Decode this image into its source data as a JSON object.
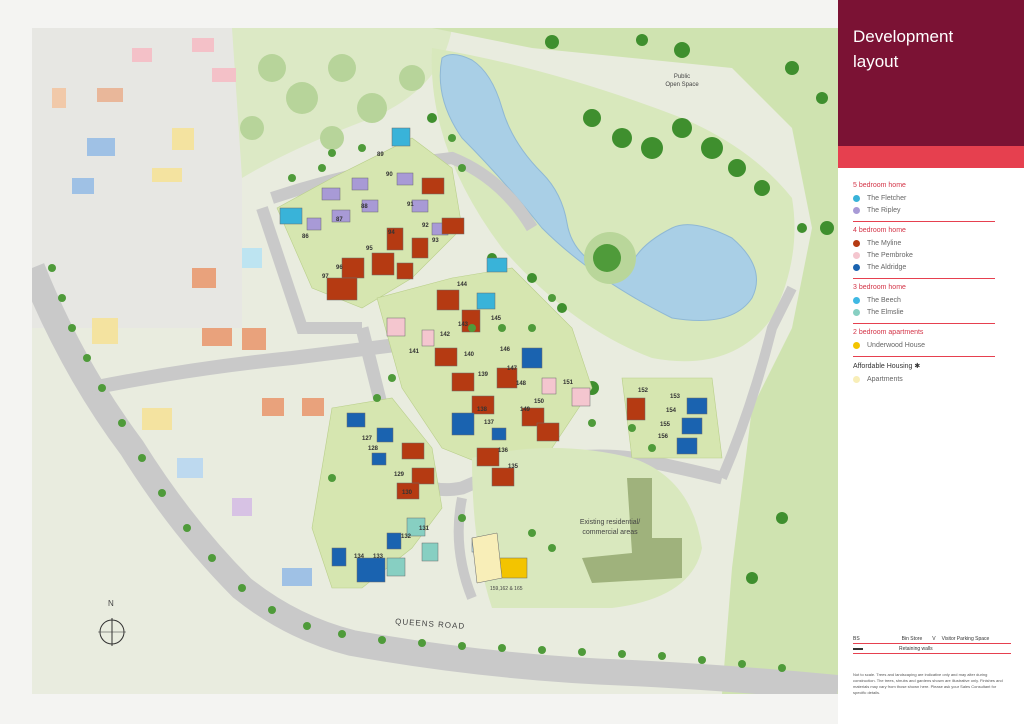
{
  "panel": {
    "title": "Development layout"
  },
  "key": {
    "groups": [
      {
        "heading": "5 bedroom home",
        "items": [
          {
            "label": "The Fletcher",
            "color": "#39b3d9"
          },
          {
            "label": "The Ripley",
            "color": "#a89ad6"
          }
        ]
      },
      {
        "heading": "4 bedroom home",
        "items": [
          {
            "label": "The Myline",
            "color": "#b53a12"
          },
          {
            "label": "The Pembroke",
            "color": "#f4c6cf"
          },
          {
            "label": "The Aldridge",
            "color": "#1a63b0"
          }
        ]
      },
      {
        "heading": "3 bedroom home",
        "items": [
          {
            "label": "The Beech",
            "color": "#3fb8e3"
          },
          {
            "label": "The Elmslie",
            "color": "#87cfc2"
          }
        ]
      },
      {
        "heading": "2 bedroom apartments",
        "items": [
          {
            "label": "Underwood House",
            "color": "#f3c400"
          }
        ]
      },
      {
        "heading": "Affordable Housing ✱",
        "items": [
          {
            "label": "Apartments",
            "color": "#f8eeb8"
          }
        ]
      }
    ]
  },
  "footer_key": {
    "bs_code": "BS",
    "bs_label": "Bin Store",
    "v_code": "V",
    "v_label": "Visitor Parking Space",
    "retaining_label": "Retaining walls"
  },
  "disclaimer": "Not to scale. Trees and landscaping are indicative only and may alter during construction. The trees, shrubs and gardens shown are illustrative only. Finishes and materials may vary from those shown here. Please ask your Sales Consultant for specific details.",
  "map": {
    "open_space_label_1": "Public",
    "open_space_label_2": "Open Space",
    "existing_label_1": "Existing residential/",
    "existing_label_2": "commercial areas",
    "road_label": "QUEENS ROAD",
    "north_label": "N",
    "apartments_plot_label": "159,162 & 165",
    "plots": [
      {
        "n": "89"
      },
      {
        "n": "90"
      },
      {
        "n": "87"
      },
      {
        "n": "88"
      },
      {
        "n": "91"
      },
      {
        "n": "86"
      },
      {
        "n": "92"
      },
      {
        "n": "93"
      },
      {
        "n": "94"
      },
      {
        "n": "95"
      },
      {
        "n": "96"
      },
      {
        "n": "97"
      },
      {
        "n": "144"
      },
      {
        "n": "143"
      },
      {
        "n": "145"
      },
      {
        "n": "142"
      },
      {
        "n": "146"
      },
      {
        "n": "141"
      },
      {
        "n": "140"
      },
      {
        "n": "147"
      },
      {
        "n": "139"
      },
      {
        "n": "148"
      },
      {
        "n": "151"
      },
      {
        "n": "150"
      },
      {
        "n": "149"
      },
      {
        "n": "138"
      },
      {
        "n": "137"
      },
      {
        "n": "136"
      },
      {
        "n": "135"
      },
      {
        "n": "127"
      },
      {
        "n": "128"
      },
      {
        "n": "129"
      },
      {
        "n": "130"
      },
      {
        "n": "131"
      },
      {
        "n": "132"
      },
      {
        "n": "133"
      },
      {
        "n": "134"
      },
      {
        "n": "152"
      },
      {
        "n": "153"
      },
      {
        "n": "154"
      },
      {
        "n": "155"
      },
      {
        "n": "156"
      }
    ]
  }
}
